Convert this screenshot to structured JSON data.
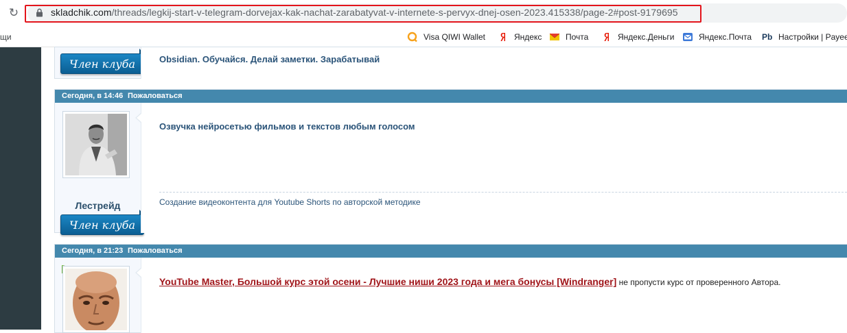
{
  "browser": {
    "url_host": "skladchik.com",
    "url_path": "/threads/legkij-start-v-telegram-dorvejax-kak-nachat-zarabatyvat-v-internete-s-pervyx-dnej-osen-2023.415338/page-2#post-9179695",
    "bookmarks_cut": "щи",
    "bookmarks": [
      {
        "label": "Visa QIWI Wallet",
        "icon": "qiwi-icon"
      },
      {
        "label": "Яндекс",
        "icon": "yandex-icon"
      },
      {
        "label": "Почта",
        "icon": "mail-icon"
      },
      {
        "label": "Яндекс.Деньги",
        "icon": "yandex-icon"
      },
      {
        "label": "Яндекс.Почта",
        "icon": "yandex-mail-icon"
      },
      {
        "label": "Настройки | Payee",
        "icon": "payeer-icon"
      }
    ],
    "payeer_glyph": "Pb"
  },
  "colors": {
    "accent_header": "#4488ad",
    "link_red": "#a0151a",
    "highlight_box": "#e3141b",
    "sidebar_dark": "#2d3c42"
  },
  "posts": [
    {
      "club_label": "Член клуба",
      "message_title": "Obsidian. Обучайся. Делай заметки. Зарабатывай"
    },
    {
      "date": "Сегодня, в 14:46",
      "report_label": "Пожаловаться",
      "username": "Лестрейд",
      "club_label": "Член клуба",
      "message_title": "Озвучка нейросетью фильмов и текстов любым голосом",
      "signature": "Создание видеоконтента для Youtube Shorts по авторской методике"
    },
    {
      "date": "Сегодня, в 21:23",
      "report_label": "Пожаловаться",
      "link_text": "YouTube Master, Большой курс этой осени - Лучшие ниши 2023 года и мега бонусы [Windranger]",
      "link_tail": " не пропусти курс от проверенного Автора."
    }
  ]
}
